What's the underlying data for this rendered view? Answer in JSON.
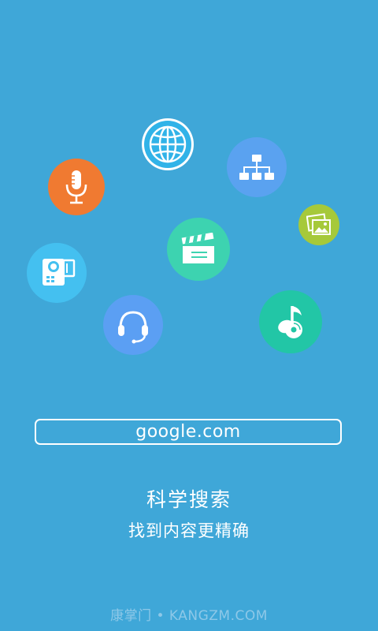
{
  "url_box": {
    "text": "google.com"
  },
  "headline": "科学搜索",
  "subline": "找到内容更精确",
  "watermark": "康掌门 • KANGZM.COM",
  "icons": [
    {
      "name": "globe-icon",
      "color": "#31b3e8"
    },
    {
      "name": "sitemap-icon",
      "color": "#5aa2f0"
    },
    {
      "name": "microphone-icon",
      "color": "#f07a31"
    },
    {
      "name": "photo-icon",
      "color": "#a6c93a"
    },
    {
      "name": "clapperboard-icon",
      "color": "#3dd3b0"
    },
    {
      "name": "camcorder-icon",
      "color": "#44c0f0"
    },
    {
      "name": "headset-icon",
      "color": "#5b9ff3"
    },
    {
      "name": "music-disc-icon",
      "color": "#22c6a6"
    }
  ],
  "colors": {
    "background": "#3fa7d8",
    "text": "#ffffff",
    "watermark": "#8dc8e8"
  }
}
